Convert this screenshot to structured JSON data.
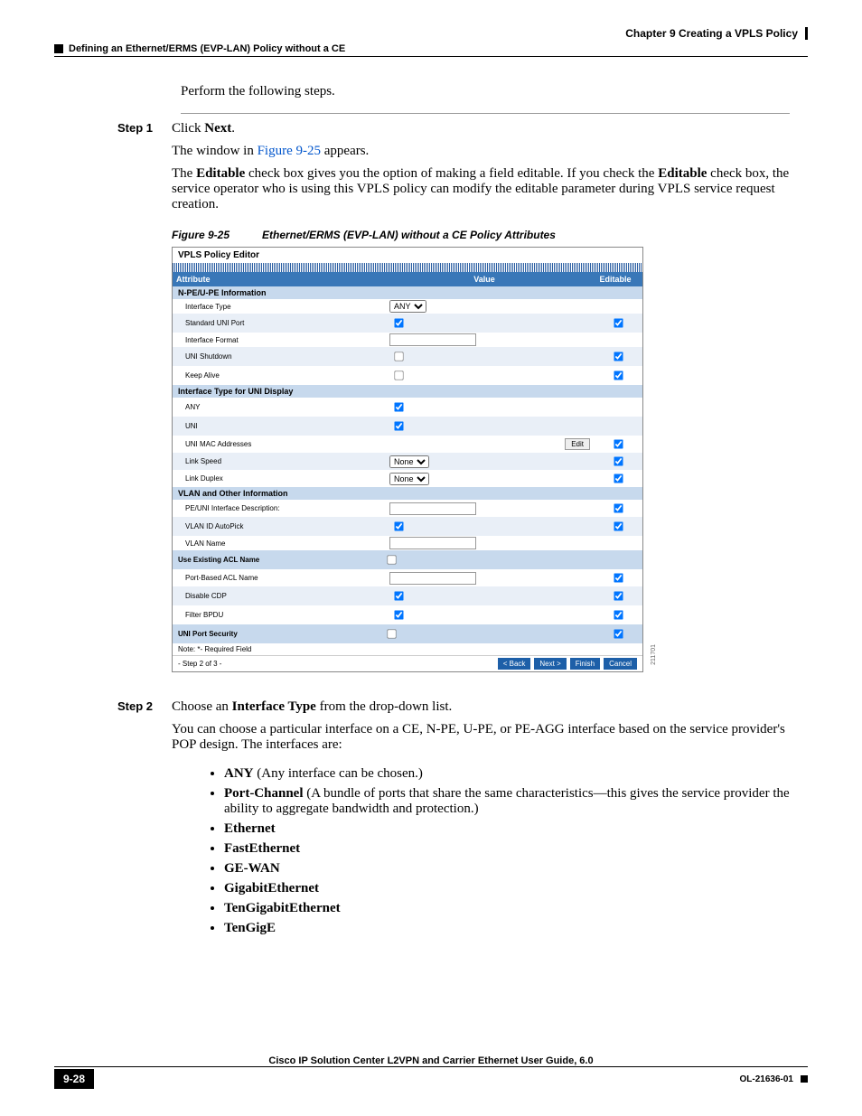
{
  "header": {
    "chapter": "Chapter 9      Creating a VPLS Policy",
    "section": "Defining an Ethernet/ERMS (EVP-LAN) Policy without a CE"
  },
  "intro": "Perform the following steps.",
  "step1": {
    "label": "Step 1",
    "line1a": "Click ",
    "line1b": "Next",
    "line1c": ".",
    "line2a": "The window in ",
    "line2b": "Figure 9-25",
    "line2c": " appears.",
    "line3a": "The ",
    "line3b": "Editable",
    "line3c": " check box gives you the option of making a field editable. If you check the ",
    "line3d": "Editable",
    "line3e": " check box, the service operator who is using this VPLS policy can modify the editable parameter during VPLS service request creation."
  },
  "figure": {
    "num": "Figure 9-25",
    "caption": "Ethernet/ERMS (EVP-LAN) without a CE Policy Attributes",
    "sideno": "211701"
  },
  "editor": {
    "title": "VPLS Policy Editor",
    "cols": {
      "attr": "Attribute",
      "val": "Value",
      "edit": "Editable"
    },
    "sec1": "N-PE/U-PE Information",
    "rows1": [
      {
        "label": "Interface Type",
        "type": "select",
        "value": "ANY",
        "edit": null
      },
      {
        "label": "Standard UNI Port",
        "type": "check",
        "checked": true,
        "edit": true
      },
      {
        "label": "Interface Format",
        "type": "text",
        "value": "",
        "edit": null
      },
      {
        "label": "UNI Shutdown",
        "type": "check",
        "checked": false,
        "edit": true
      },
      {
        "label": "Keep Alive",
        "type": "check",
        "checked": false,
        "edit": true
      }
    ],
    "sec2": "Interface Type for UNI Display",
    "rows2": [
      {
        "label": "ANY",
        "type": "check",
        "checked": true,
        "edit": null
      },
      {
        "label": "UNI",
        "type": "check",
        "checked": true,
        "edit": null
      },
      {
        "label": "UNI MAC Addresses",
        "type": "editbtn",
        "btn": "Edit",
        "edit": true
      },
      {
        "label": "Link Speed",
        "type": "select",
        "value": "None",
        "edit": true
      },
      {
        "label": "Link Duplex",
        "type": "select",
        "value": "None",
        "edit": true
      }
    ],
    "sec3": "VLAN and Other Information",
    "rows3": [
      {
        "label": "PE/UNI Interface Description:",
        "type": "text",
        "value": "",
        "edit": true
      },
      {
        "label": "VLAN ID AutoPick",
        "type": "check",
        "checked": true,
        "edit": true
      },
      {
        "label": "VLAN Name",
        "type": "text",
        "value": "",
        "edit": null
      }
    ],
    "sec4": "Use Existing ACL Name",
    "sec4chk": false,
    "rows4": [
      {
        "label": "Port-Based ACL Name",
        "type": "text",
        "value": "",
        "edit": true
      },
      {
        "label": "Disable CDP",
        "type": "check",
        "checked": true,
        "edit": true
      },
      {
        "label": "Filter BPDU",
        "type": "check",
        "checked": true,
        "edit": true
      }
    ],
    "sec5": "UNI Port Security",
    "sec5chk": false,
    "sec5edit": true,
    "note": "Note: *- Required Field",
    "stepof": "- Step 2 of 3 -",
    "btns": {
      "back": "< Back",
      "next": "Next >",
      "finish": "Finish",
      "cancel": "Cancel"
    }
  },
  "step2": {
    "label": "Step 2",
    "line1a": "Choose an ",
    "line1b": "Interface Type",
    "line1c": " from the drop-down list.",
    "line2": "You can choose a particular interface on a CE, N-PE, U-PE, or PE-AGG interface based on the service provider's POP design. The interfaces are:",
    "bullets": [
      {
        "b": "ANY",
        "t": " (Any interface can be chosen.)"
      },
      {
        "b": "Port-Channel",
        "t": " (A bundle of ports that share the same characteristics—this gives the service provider the ability to aggregate bandwidth and protection.)"
      },
      {
        "b": "Ethernet",
        "t": ""
      },
      {
        "b": "FastEthernet",
        "t": ""
      },
      {
        "b": "GE-WAN",
        "t": ""
      },
      {
        "b": "GigabitEthernet",
        "t": ""
      },
      {
        "b": "TenGigabitEthernet",
        "t": ""
      },
      {
        "b": "TenGigE",
        "t": ""
      }
    ]
  },
  "footer": {
    "title": "Cisco IP Solution Center L2VPN and Carrier Ethernet User Guide, 6.0",
    "page": "9-28",
    "doc": "OL-21636-01"
  }
}
